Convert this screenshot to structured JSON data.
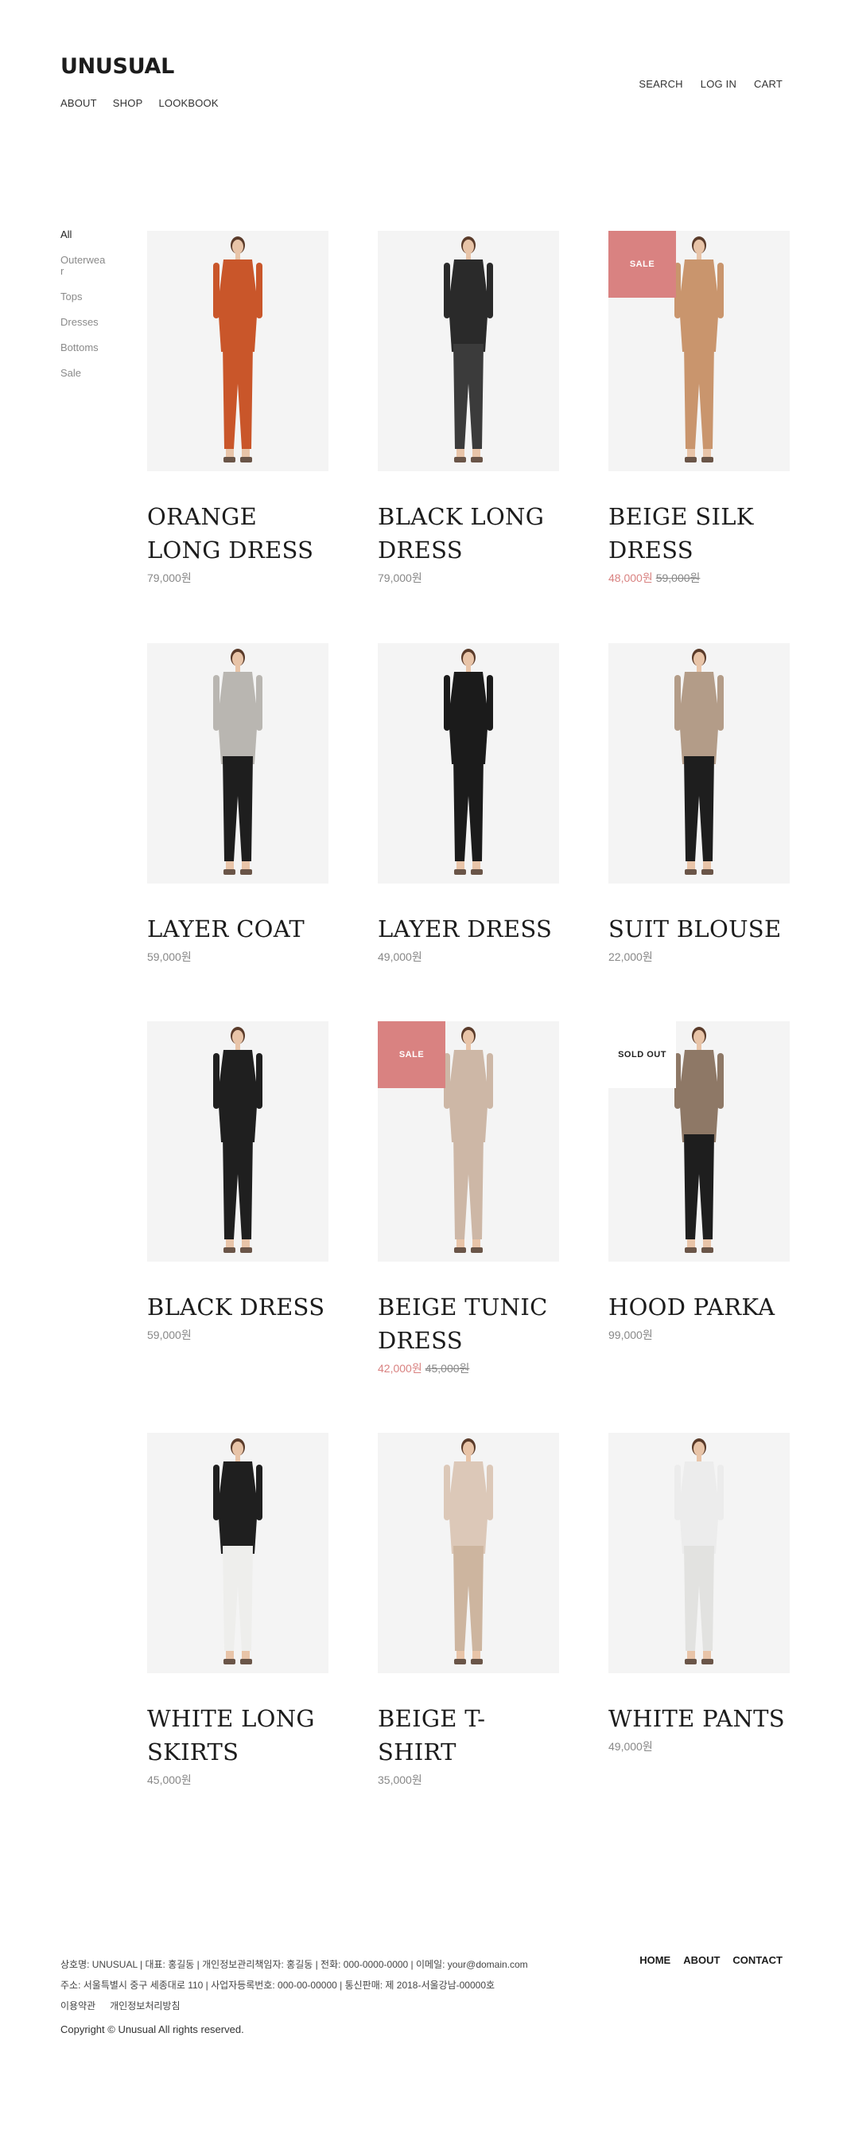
{
  "brand": {
    "logo": "UNUSUAL"
  },
  "main_nav": [
    "ABOUT",
    "SHOP",
    "LOOKBOOK"
  ],
  "util_nav": [
    "SEARCH",
    "LOG IN",
    "CART"
  ],
  "categories": [
    "All",
    "Outerwear",
    "Tops",
    "Dresses",
    "Bottoms",
    "Sale"
  ],
  "badges": {
    "sale": "SALE",
    "sold_out": "SOLD OUT"
  },
  "products": [
    {
      "name": "ORANGE LONG DRESS",
      "price": "79,000원",
      "original_price": "",
      "badge": "",
      "colors": {
        "top": "#c9562a",
        "bottom": "#c9562a"
      }
    },
    {
      "name": "BLACK LONG DRESS",
      "price": "79,000원",
      "original_price": "",
      "badge": "",
      "colors": {
        "top": "#2a2a2a",
        "bottom": "#3b3b3b"
      }
    },
    {
      "name": "BEIGE SILK DRESS",
      "price": "48,000원",
      "original_price": "59,000원",
      "badge": "SALE",
      "colors": {
        "top": "#c9956d",
        "bottom": "#c9956d"
      }
    },
    {
      "name": "LAYER COAT",
      "price": "59,000원",
      "original_price": "",
      "badge": "",
      "colors": {
        "top": "#b9b6b1",
        "bottom": "#1e1e1e"
      }
    },
    {
      "name": "LAYER DRESS",
      "price": "49,000원",
      "original_price": "",
      "badge": "",
      "colors": {
        "top": "#1b1b1b",
        "bottom": "#1b1b1b"
      }
    },
    {
      "name": "SUIT BLOUSE",
      "price": "22,000원",
      "original_price": "",
      "badge": "",
      "colors": {
        "top": "#b39c88",
        "bottom": "#1e1e1e"
      }
    },
    {
      "name": "BLACK DRESS",
      "price": "59,000원",
      "original_price": "",
      "badge": "",
      "colors": {
        "top": "#1f1f1f",
        "bottom": "#1f1f1f"
      }
    },
    {
      "name": "BEIGE TUNIC DRESS",
      "price": "42,000원",
      "original_price": "45,000원",
      "badge": "SALE",
      "colors": {
        "top": "#cdb7a6",
        "bottom": "#cdb7a6"
      }
    },
    {
      "name": "HOOD PARKA",
      "price": "99,000원",
      "original_price": "",
      "badge": "SOLD OUT",
      "colors": {
        "top": "#8e7866",
        "bottom": "#1e1e1e"
      }
    },
    {
      "name": "WHITE LONG SKIRTS",
      "price": "45,000원",
      "original_price": "",
      "badge": "",
      "colors": {
        "top": "#1f1f1f",
        "bottom": "#eeeeec"
      }
    },
    {
      "name": "BEIGE T-SHIRT",
      "price": "35,000원",
      "original_price": "",
      "badge": "",
      "colors": {
        "top": "#dcc8b8",
        "bottom": "#cdb59f"
      }
    },
    {
      "name": "WHITE PANTS",
      "price": "49,000원",
      "original_price": "",
      "badge": "",
      "colors": {
        "top": "#ececec",
        "bottom": "#e2e2e0"
      }
    }
  ],
  "footer": {
    "info_line1": "상호명: UNUSUAL | 대표: 홍길동 | 개인정보관리책임자: 홍길동 | 전화: 000-0000-0000 | 이메일: your@domain.com",
    "info_line2": "주소: 서울특별시 중구 세종대로 110 | 사업자등록번호: 000-00-00000 | 통신판매: 제 2018-서울강남-00000호",
    "links": [
      "이용약관",
      "개인정보처리방침"
    ],
    "copyright": "Copyright © Unusual All rights reserved.",
    "nav": [
      "HOME",
      "ABOUT",
      "CONTACT"
    ]
  },
  "colors": {
    "accent": "#d98281",
    "placeholder_bg": "#f4f4f4",
    "text": "#222222"
  }
}
